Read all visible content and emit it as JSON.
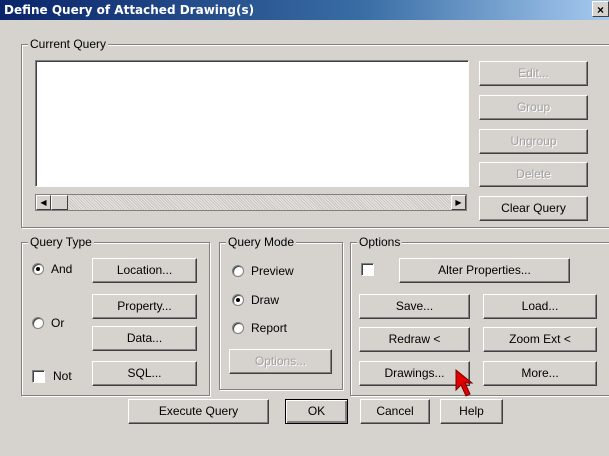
{
  "window": {
    "title": "Define Query of Attached Drawing(s)",
    "close_glyph": "×"
  },
  "current_query": {
    "legend": "Current Query",
    "buttons": {
      "edit": "Edit...",
      "group": "Group",
      "ungroup": "Ungroup",
      "delete": "Delete",
      "clear": "Clear Query"
    },
    "scroll_left": "◀",
    "scroll_right": "▶"
  },
  "query_type": {
    "legend": "Query Type",
    "and_label": "And",
    "or_label": "Or",
    "not_label": "Not",
    "selected": "And",
    "not_checked": false,
    "buttons": {
      "location": "Location...",
      "property": "Property...",
      "data": "Data...",
      "sql": "SQL..."
    }
  },
  "query_mode": {
    "legend": "Query Mode",
    "preview_label": "Preview",
    "draw_label": "Draw",
    "report_label": "Report",
    "selected": "Draw",
    "options_button": "Options..."
  },
  "options": {
    "legend": "Options",
    "alter_checked": false,
    "buttons": {
      "alter": "Alter Properties...",
      "save": "Save...",
      "load": "Load...",
      "redraw": "Redraw <",
      "zoom": "Zoom Ext <",
      "drawings": "Drawings...",
      "more": "More..."
    }
  },
  "footer": {
    "execute": "Execute Query",
    "ok": "OK",
    "cancel": "Cancel",
    "help": "Help"
  },
  "colors": {
    "face": "#d6d3ce",
    "title_start": "#0a246a",
    "cursor": "#e00000"
  }
}
